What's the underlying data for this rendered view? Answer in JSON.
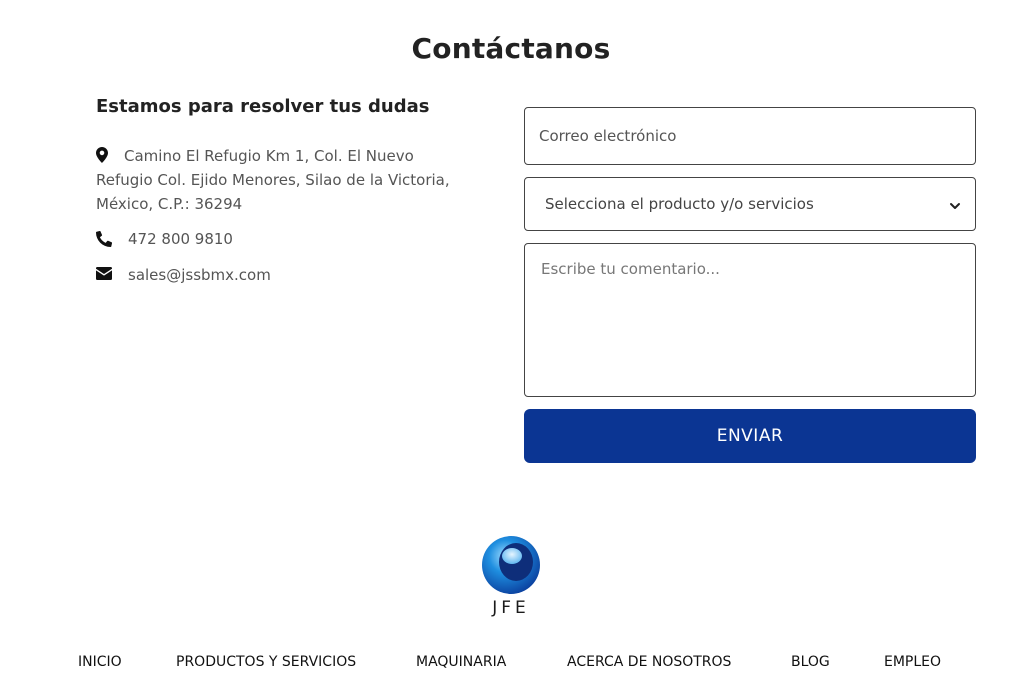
{
  "page": {
    "title": "Contáctanos"
  },
  "contact_info": {
    "heading": "Estamos para resolver tus dudas",
    "address": "Camino El Refugio Km 1, Col. El Nuevo Refugio Col. Ejido Menores, Silao de la Victoria, México, C.P.: 36294",
    "phone": "472 800 9810",
    "email": "sales@jssbmx.com",
    "icons": {
      "address": "map-pin-icon",
      "phone": "phone-icon",
      "email": "envelope-icon"
    }
  },
  "form": {
    "email_placeholder": "Correo electrónico",
    "select_value": "Selecciona el producto y/o servicios",
    "comment_placeholder": "Escribe tu comentario...",
    "submit_label": "ENVIAR",
    "submit_color": "#0b3593"
  },
  "logo": {
    "text": "JFE"
  },
  "footer_nav": {
    "items": [
      {
        "label": "INICIO"
      },
      {
        "label": "PRODUCTOS Y SERVICIOS"
      },
      {
        "label": "MAQUINARIA"
      },
      {
        "label": "ACERCA DE NOSOTROS"
      },
      {
        "label": "BLOG"
      },
      {
        "label": "EMPLEO"
      }
    ]
  }
}
